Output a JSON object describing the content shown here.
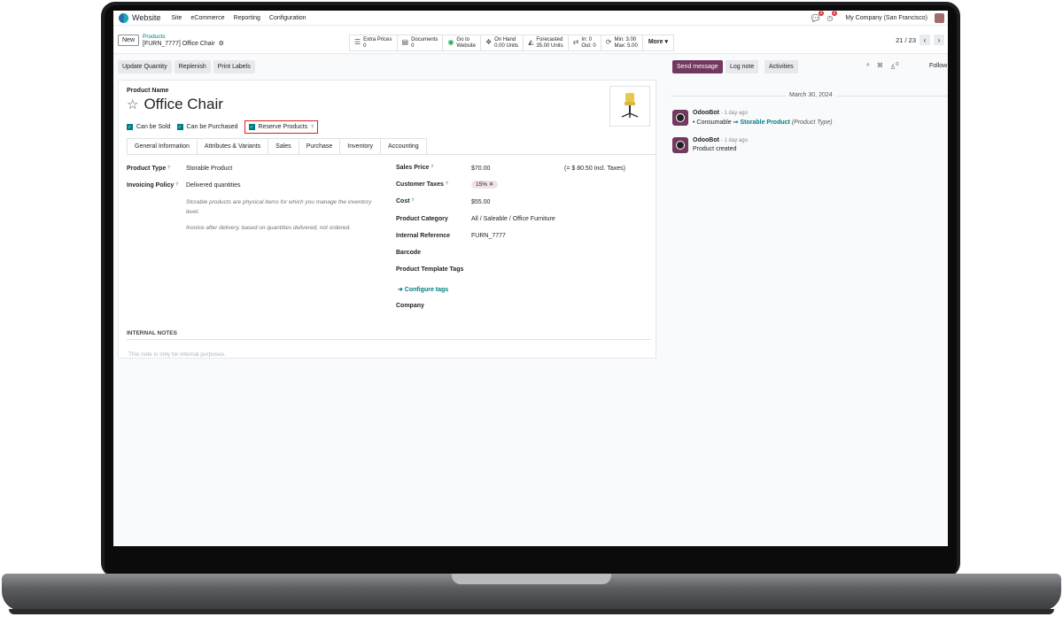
{
  "nav": {
    "app": "Website",
    "items": [
      "Site",
      "eCommerce",
      "Reporting",
      "Configuration"
    ],
    "chat_count": "3",
    "activity_count": "2",
    "company": "My Company (San Francisco)"
  },
  "control": {
    "new_label": "New",
    "breadcrumb_parent": "Products",
    "record": "[FURN_7777] Office Chair",
    "pager": "21 / 23",
    "more_label": "More ▾"
  },
  "smart_buttons": [
    {
      "icon": "list-icon",
      "glyph": "☰",
      "line1": "Extra Prices",
      "line2": "0"
    },
    {
      "icon": "document-icon",
      "glyph": "▤",
      "line1": "Documents",
      "line2": "0"
    },
    {
      "icon": "globe-icon",
      "glyph": "◉",
      "line1": "Go to",
      "line2": "Website"
    },
    {
      "icon": "cubes-icon",
      "glyph": "❖",
      "line1": "On Hand",
      "line2": "0.00 Units"
    },
    {
      "icon": "area-chart-icon",
      "glyph": "◭",
      "line1": "Forecasted",
      "line2": "35.00 Units"
    },
    {
      "icon": "exchange-icon",
      "glyph": "⇄",
      "line1": "In: 0",
      "line2": "Out: 0"
    },
    {
      "icon": "refresh-icon",
      "glyph": "⟳",
      "line1": "Min: 3.00",
      "line2": "Max: 5.00"
    }
  ],
  "actions": [
    "Update Quantity",
    "Replenish",
    "Print Labels"
  ],
  "form": {
    "product_name_label": "Product Name",
    "product_name": "Office Chair",
    "checks": [
      "Can be Sold",
      "Can be Purchased",
      "Reserve Products"
    ],
    "help_mark": "?",
    "tabs": [
      "General Information",
      "Attributes & Variants",
      "Sales",
      "Purchase",
      "Inventory",
      "Accounting"
    ],
    "product_type_label": "Product Type",
    "product_type": "Storable Product",
    "invoicing_label": "Invoicing Policy",
    "invoicing": "Delivered quantities",
    "note1": "Storable products are physical items for which you manage the inventory level.",
    "note2": "Invoice after delivery, based on quantities delivered, not ordered.",
    "sales_price_label": "Sales Price",
    "sales_price": "$70.00",
    "incl_taxes": "(= $ 80.50 Incl. Taxes)",
    "taxes_label": "Customer Taxes",
    "tax_chip": "15% ✕",
    "cost_label": "Cost",
    "cost": "$55.00",
    "category_label": "Product Category",
    "category": "All / Saleable / Office Furniture",
    "ref_label": "Internal Reference",
    "ref": "FURN_7777",
    "barcode_label": "Barcode",
    "tags_label": "Product Template Tags",
    "configure_tags": "➔ Configure tags",
    "company_label": "Company",
    "notes_heading": "INTERNAL NOTES",
    "notes_placeholder": "This note is only for internal purposes."
  },
  "chatter": {
    "send": "Send message",
    "log": "Log note",
    "activities": "Activities",
    "follow": "Follow",
    "followers": "0",
    "date": "March 30, 2024",
    "messages": [
      {
        "author": "OdooBot",
        "time": "- 1 day ago",
        "body_a": "•  Consumable",
        "body_b": "➞ Storable Product",
        "body_c": "(Product Type)"
      },
      {
        "author": "OdooBot",
        "time": "- 1 day ago",
        "body_a": "Product created"
      }
    ]
  }
}
